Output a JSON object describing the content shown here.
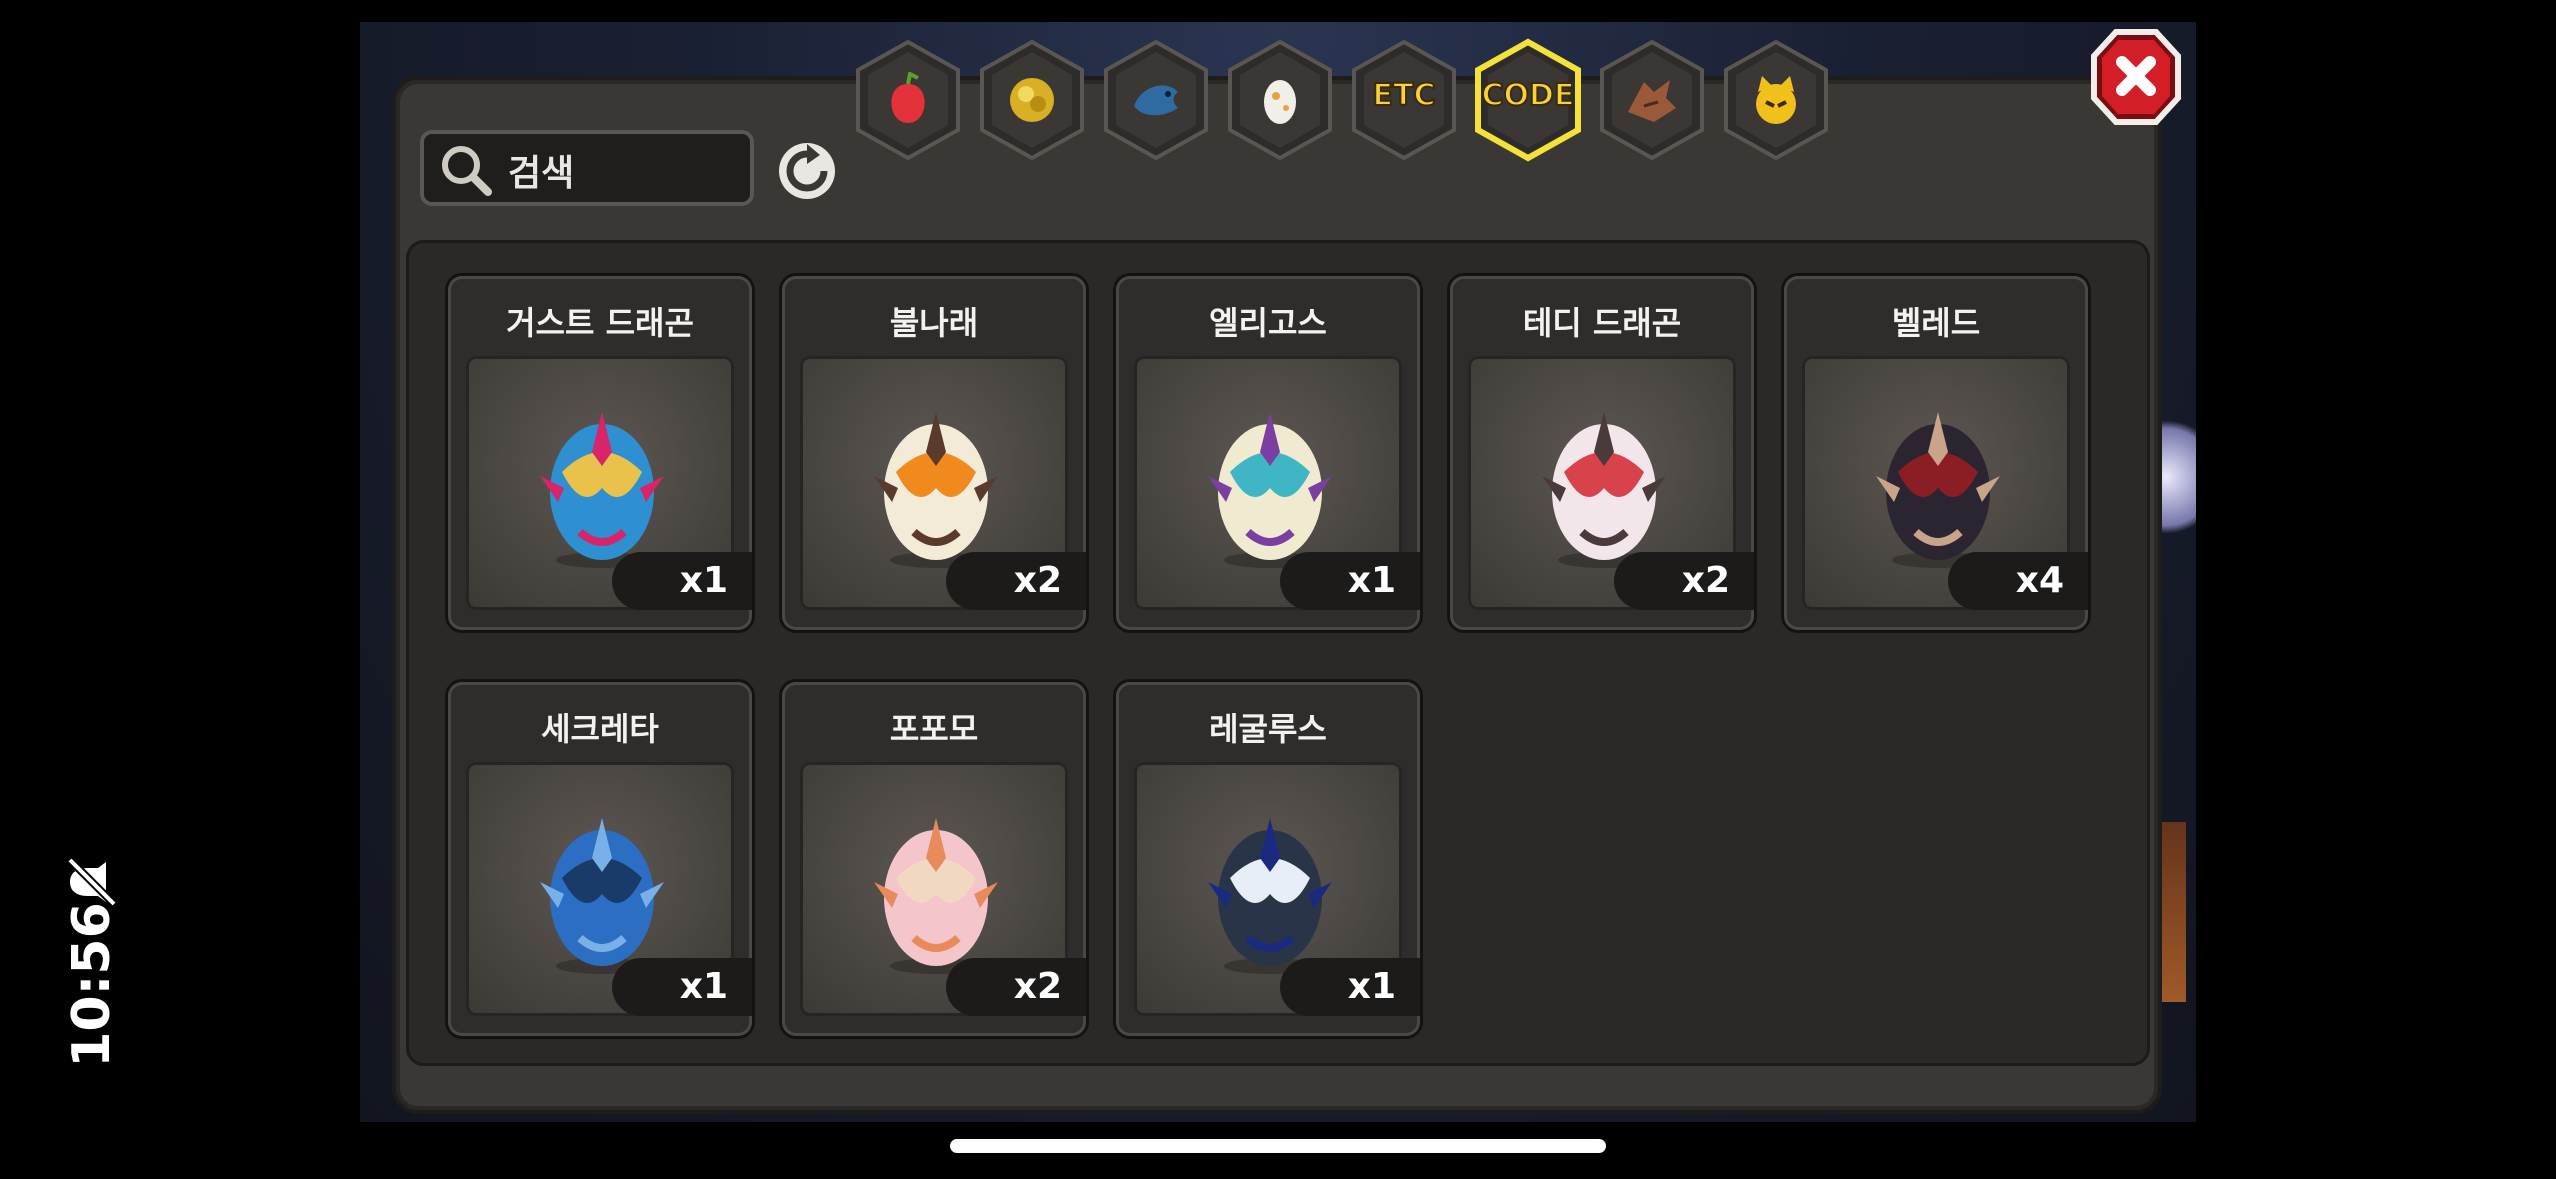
{
  "status": {
    "time": "10:56"
  },
  "search": {
    "placeholder": "검색"
  },
  "tabs": [
    {
      "id": "fruit",
      "label": "",
      "icon": "fruit-icon",
      "active": false
    },
    {
      "id": "gold",
      "label": "",
      "icon": "gold-icon",
      "active": false
    },
    {
      "id": "fish",
      "label": "",
      "icon": "fish-icon",
      "active": false
    },
    {
      "id": "egg",
      "label": "",
      "icon": "egg-icon",
      "active": false
    },
    {
      "id": "etc",
      "label": "ETC",
      "icon": "",
      "active": false
    },
    {
      "id": "code",
      "label": "CODE",
      "icon": "",
      "active": true
    },
    {
      "id": "dragon",
      "label": "",
      "icon": "dragon-head-icon",
      "active": false
    },
    {
      "id": "pet",
      "label": "",
      "icon": "pet-face-icon",
      "active": false
    }
  ],
  "items": [
    {
      "name": "거스트 드래곤",
      "qty": "x1",
      "colors": [
        "#2e8fd1",
        "#e8c24a",
        "#d8246a"
      ]
    },
    {
      "name": "불나래",
      "qty": "x2",
      "colors": [
        "#f3ead8",
        "#f08a1c",
        "#5a3a2a"
      ]
    },
    {
      "name": "엘리고스",
      "qty": "x1",
      "colors": [
        "#f0ead0",
        "#3fb6c4",
        "#7a3fa0"
      ]
    },
    {
      "name": "테디 드래곤",
      "qty": "x2",
      "colors": [
        "#f3e6ea",
        "#d8424a",
        "#4a3a3a"
      ]
    },
    {
      "name": "벨레드",
      "qty": "x4",
      "colors": [
        "#2a2530",
        "#8a1e24",
        "#c8a58a"
      ]
    },
    {
      "name": "세크레타",
      "qty": "x1",
      "colors": [
        "#2c6ec4",
        "#1a3a6a",
        "#7ab0e8"
      ]
    },
    {
      "name": "포포모",
      "qty": "x2",
      "colors": [
        "#f4c6cc",
        "#f0d8c2",
        "#e88a5a"
      ]
    },
    {
      "name": "레굴루스",
      "qty": "x1",
      "colors": [
        "#2a3448",
        "#e8eef8",
        "#1a2a80"
      ]
    }
  ]
}
